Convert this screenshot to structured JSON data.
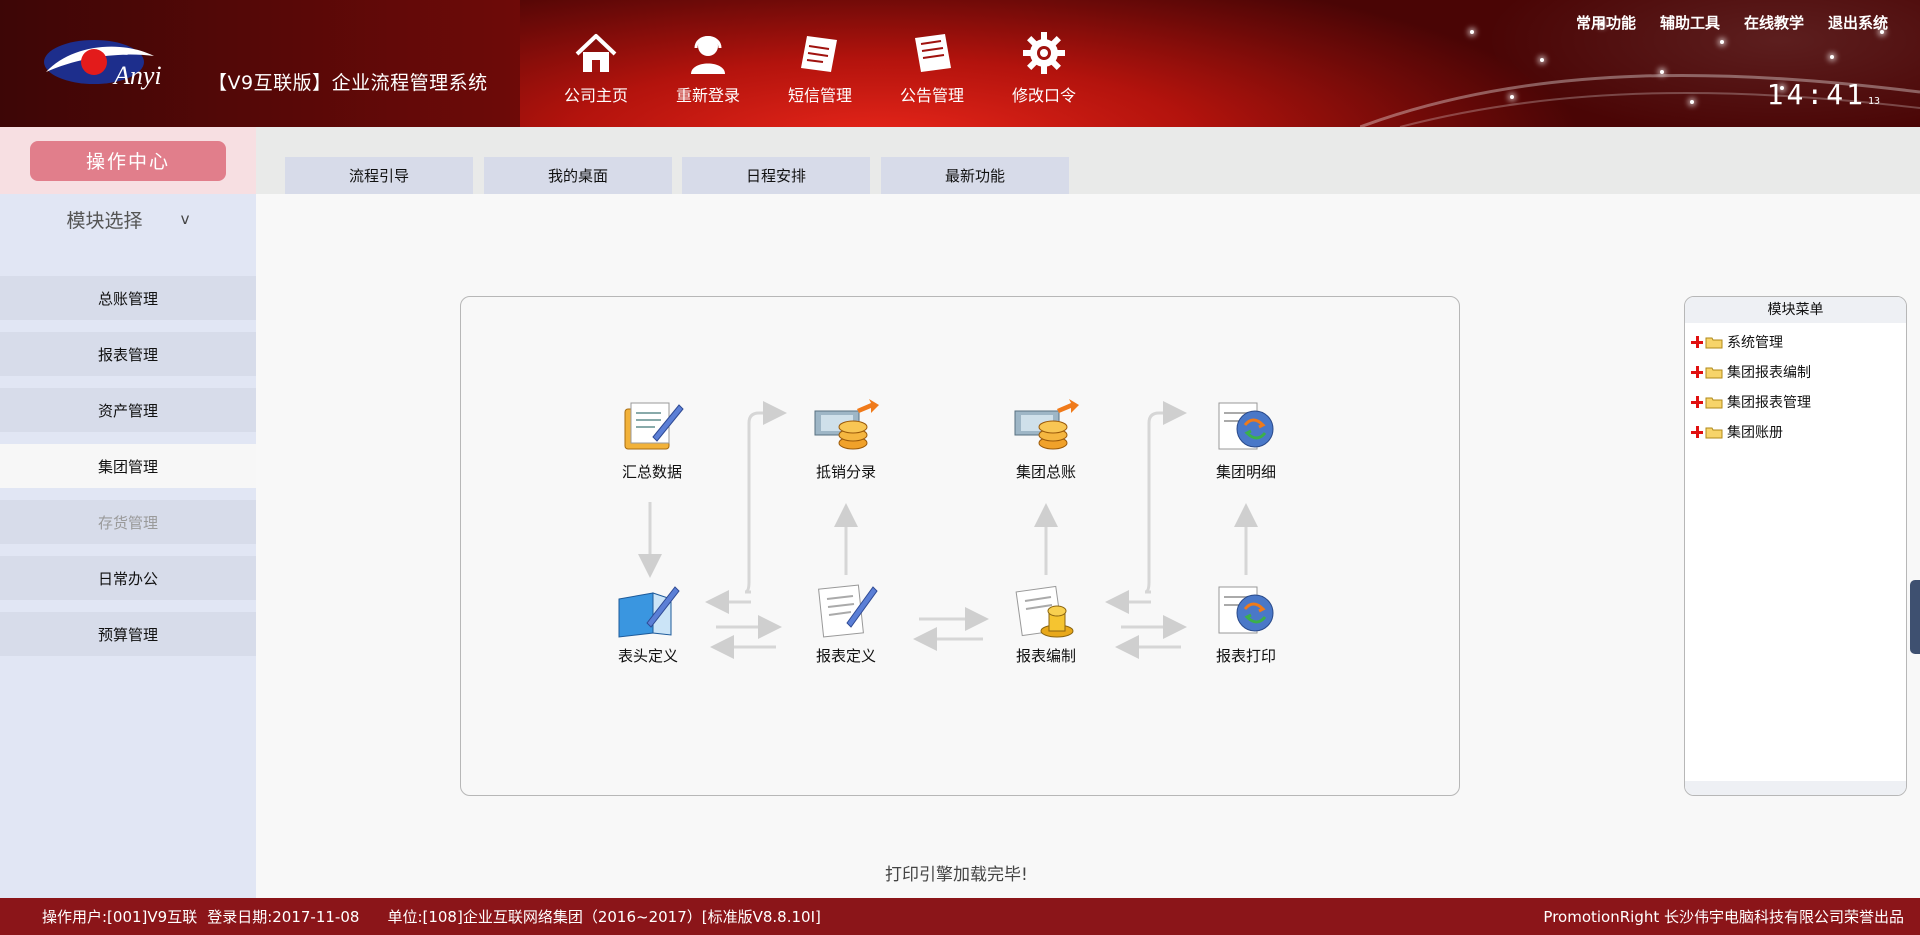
{
  "header": {
    "logo_text": "Anyi",
    "title": "【V9互联版】企业流程管理系统",
    "nav": [
      {
        "label": "公司主页",
        "icon": "home-icon"
      },
      {
        "label": "重新登录",
        "icon": "user-icon"
      },
      {
        "label": "短信管理",
        "icon": "sms-icon"
      },
      {
        "label": "公告管理",
        "icon": "notice-icon"
      },
      {
        "label": "修改口令",
        "icon": "gear-icon"
      }
    ],
    "top_links": [
      "常用功能",
      "辅助工具",
      "在线教学",
      "退出系统"
    ],
    "clock": {
      "time": "14:41",
      "seconds": "13"
    }
  },
  "sidebar": {
    "op_center": "操作中心",
    "module_select": "模块选择",
    "module_select_chevron": "v",
    "items": [
      {
        "label": "总账管理"
      },
      {
        "label": "报表管理"
      },
      {
        "label": "资产管理"
      },
      {
        "label": "集团管理"
      },
      {
        "label": "存货管理"
      },
      {
        "label": "日常办公"
      },
      {
        "label": "预算管理"
      }
    ]
  },
  "tabs": [
    {
      "label": "流程引导"
    },
    {
      "label": "我的桌面"
    },
    {
      "label": "日程安排"
    },
    {
      "label": "最新功能"
    }
  ],
  "flow": {
    "nodes": [
      {
        "label": "汇总数据",
        "icon": "edit-document-icon"
      },
      {
        "label": "抵销分录",
        "icon": "money-coins-icon"
      },
      {
        "label": "集团总账",
        "icon": "money-coins-icon"
      },
      {
        "label": "集团明细",
        "icon": "globe-document-icon"
      },
      {
        "label": "表头定义",
        "icon": "book-pen-icon"
      },
      {
        "label": "报表定义",
        "icon": "edit-document-icon"
      },
      {
        "label": "报表编制",
        "icon": "stamp-document-icon"
      },
      {
        "label": "报表打印",
        "icon": "globe-document-icon"
      }
    ]
  },
  "module_menu": {
    "title": "模块菜单",
    "items": [
      {
        "label": "系统管理"
      },
      {
        "label": "集团报表编制"
      },
      {
        "label": "集团报表管理"
      },
      {
        "label": "集团账册"
      }
    ]
  },
  "status": "打印引擎加载完毕!",
  "footer": {
    "user": "操作用户:[001]V9互联",
    "login_date": "登录日期:2017-11-08",
    "unit": "单位:[108]企业互联网络集团（2016~2017）[标准版V8.8.10I]",
    "right": "PromotionRight 长沙伟宇电脑科技有限公司荣誉出品"
  }
}
